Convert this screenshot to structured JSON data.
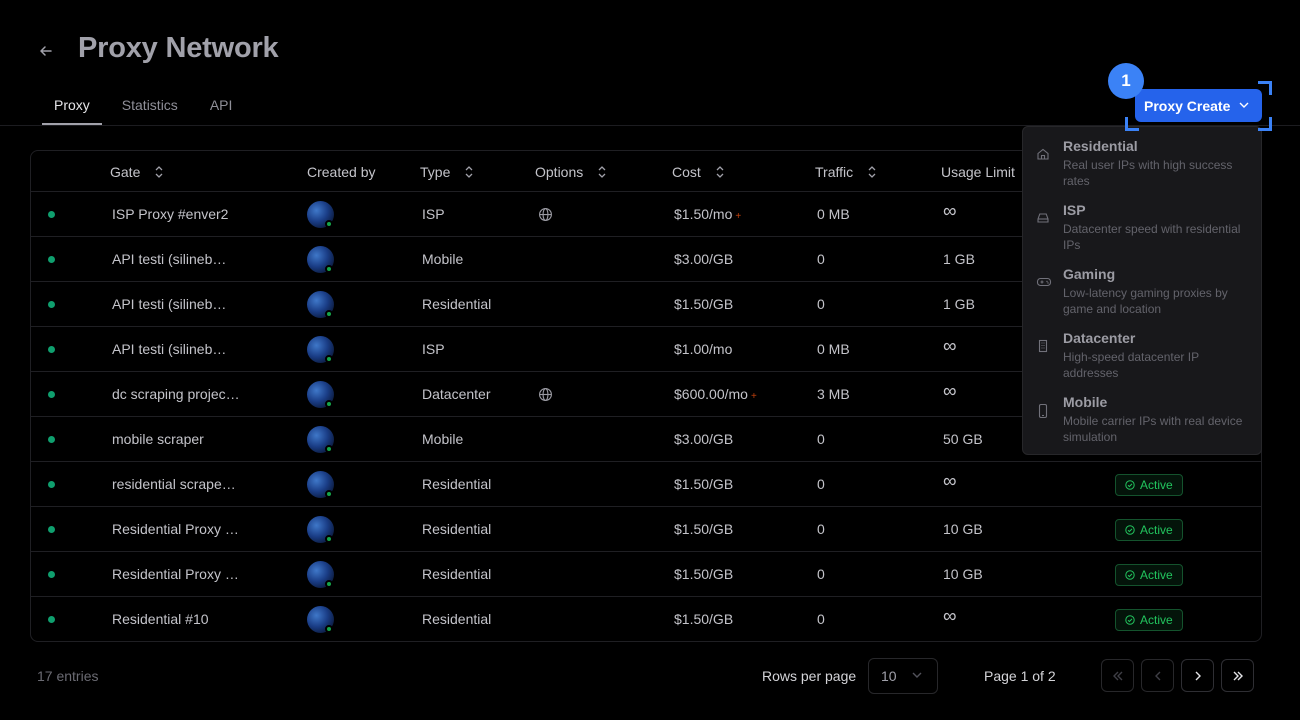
{
  "header": {
    "title": "Proxy Network"
  },
  "tabs": [
    {
      "label": "Proxy"
    },
    {
      "label": "Statistics"
    },
    {
      "label": "API"
    }
  ],
  "create": {
    "label": "Proxy Create",
    "step_badge": "1"
  },
  "table": {
    "columns": {
      "gate": "Gate",
      "created_by": "Created by",
      "type": "Type",
      "options": "Options",
      "cost": "Cost",
      "traffic": "Traffic",
      "usage_limit": "Usage Limit"
    },
    "rows": [
      {
        "gate": "ISP Proxy #enver2",
        "type": "ISP",
        "options_icon": "globe-icon",
        "cost": "$1.50/mo",
        "cost_plus": "+",
        "traffic": "0 MB",
        "usage": "∞",
        "status": ""
      },
      {
        "gate": "API testi (silineb…",
        "type": "Mobile",
        "options_icon": "",
        "cost": "$3.00/GB",
        "cost_plus": "",
        "traffic": "0",
        "usage": "1 GB",
        "status": ""
      },
      {
        "gate": "API testi (silineb…",
        "type": "Residential",
        "options_icon": "",
        "cost": "$1.50/GB",
        "cost_plus": "",
        "traffic": "0",
        "usage": "1 GB",
        "status": ""
      },
      {
        "gate": "API testi (silineb…",
        "type": "ISP",
        "options_icon": "",
        "cost": "$1.00/mo",
        "cost_plus": "",
        "traffic": "0 MB",
        "usage": "∞",
        "status": ""
      },
      {
        "gate": "dc scraping projec…",
        "type": "Datacenter",
        "options_icon": "globe-icon",
        "cost": "$600.00/mo",
        "cost_plus": "+",
        "traffic": "3 MB",
        "usage": "∞",
        "status": ""
      },
      {
        "gate": "mobile scraper",
        "type": "Mobile",
        "options_icon": "",
        "cost": "$3.00/GB",
        "cost_plus": "",
        "traffic": "0",
        "usage": "50 GB",
        "status": ""
      },
      {
        "gate": "residential scrape…",
        "type": "Residential",
        "options_icon": "",
        "cost": "$1.50/GB",
        "cost_plus": "",
        "traffic": "0",
        "usage": "∞",
        "status": "Active"
      },
      {
        "gate": "Residential Proxy …",
        "type": "Residential",
        "options_icon": "",
        "cost": "$1.50/GB",
        "cost_plus": "",
        "traffic": "0",
        "usage": "10 GB",
        "status": "Active"
      },
      {
        "gate": "Residential Proxy …",
        "type": "Residential",
        "options_icon": "",
        "cost": "$1.50/GB",
        "cost_plus": "",
        "traffic": "0",
        "usage": "10 GB",
        "status": "Active"
      },
      {
        "gate": "Residential #10",
        "type": "Residential",
        "options_icon": "",
        "cost": "$1.50/GB",
        "cost_plus": "",
        "traffic": "0",
        "usage": "∞",
        "status": "Active"
      }
    ]
  },
  "menu": {
    "items": [
      {
        "title": "Residential",
        "desc": "Real user IPs with high success rates",
        "icon": "home-icon"
      },
      {
        "title": "ISP",
        "desc": "Datacenter speed with residential IPs",
        "icon": "hard-drive-icon"
      },
      {
        "title": "Gaming",
        "desc": "Low-latency gaming proxies by game and location",
        "icon": "gamepad-icon"
      },
      {
        "title": "Datacenter",
        "desc": "High-speed datacenter IP addresses",
        "icon": "building-icon"
      },
      {
        "title": "Mobile",
        "desc": "Mobile carrier IPs with real device simulation",
        "icon": "smartphone-icon"
      }
    ]
  },
  "footer": {
    "entries": "17 entries",
    "rows_per_page_label": "Rows per page",
    "rows_per_page_value": "10",
    "page_info": "Page 1 of 2"
  },
  "colors": {
    "accent": "#2563eb",
    "status_active": "#22c55e",
    "status_dot": "#0f9f6e"
  }
}
